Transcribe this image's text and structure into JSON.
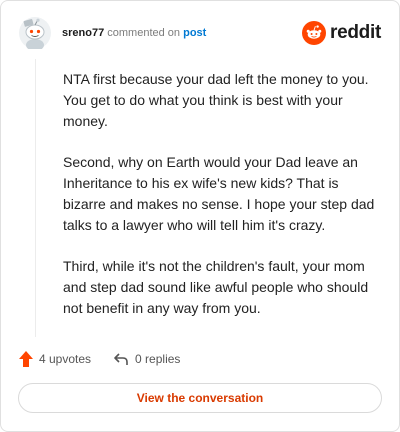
{
  "header": {
    "username": "sreno77",
    "action_text": "commented on",
    "post_link": "post",
    "logo_text": "reddit"
  },
  "comment": {
    "paragraphs": [
      "NTA first because your dad left the money to you. You get to do what you think is best with your money.",
      "Second, why on Earth would your Dad leave an Inheritance to his ex wife's new kids? That is bizarre and makes no sense. I hope your step dad talks to a lawyer who will tell him it's crazy.",
      "Third, while it's not the children's fault, your mom and step dad sound like awful people who should not benefit in any way from you."
    ]
  },
  "actions": {
    "upvotes": "4 upvotes",
    "replies": "0 replies"
  },
  "footer": {
    "view_label": "View the conversation"
  },
  "colors": {
    "brand": "#ff4500",
    "link": "#0079d3",
    "cta": "#d93a00"
  },
  "icons": [
    "snoo-avatar",
    "reddit-logo-icon",
    "upvote-arrow-icon",
    "reply-icon"
  ]
}
